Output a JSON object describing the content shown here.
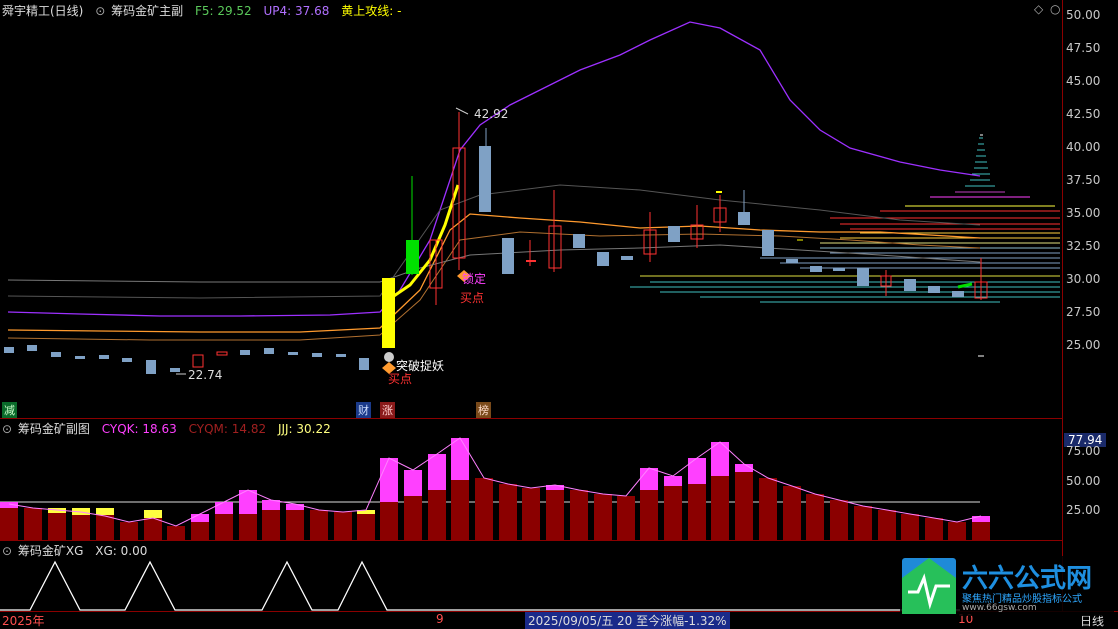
{
  "main": {
    "title": "舜宇精工(日线)",
    "indicator": "筹码金矿主副",
    "f5_label": "F5: 29.52",
    "up4_label": "UP4: 37.68",
    "hs_label": "黄上攻线: -",
    "high_label": "42.92",
    "low_label": "22.74",
    "signal_breakout": "突破捉妖",
    "signal_buy1": "买点",
    "signal_lock": "锁定",
    "signal_buy2": "买点",
    "yaxis": [
      "50.00",
      "47.50",
      "45.00",
      "42.50",
      "40.00",
      "37.50",
      "35.00",
      "32.50",
      "30.00",
      "27.50",
      "25.00"
    ],
    "flags": {
      "jian": "减",
      "cai": "财",
      "zhang": "涨",
      "bang": "榜"
    },
    "colors": {
      "up": "#ff3232",
      "down": "#7fa1c5",
      "purple": "#9d30ff",
      "orange": "#ff9a2e",
      "yellow": "#ffff00",
      "green": "#00e000"
    }
  },
  "sub1": {
    "title": "筹码金矿副图",
    "cyqk": "CYQK: 18.63",
    "cyqm": "CYQM: 14.82",
    "jjj": "JJJ: 30.22",
    "value_tag": "77.94",
    "yaxis": [
      "75.00",
      "50.00",
      "25.00"
    ]
  },
  "sub2": {
    "title": "筹码金矿XG",
    "xg": "XG: 0.00"
  },
  "footer": {
    "year": "2025年",
    "month9": "9",
    "info": "2025/09/05/五 20 至今涨幅-1.32%",
    "month10": "10",
    "period": "日线"
  },
  "logo": {
    "name": "六六公式网",
    "slogan": "聚焦热门精品炒股指标公式",
    "url": "www.66gsw.com"
  },
  "watermark": "六六公式网"
}
